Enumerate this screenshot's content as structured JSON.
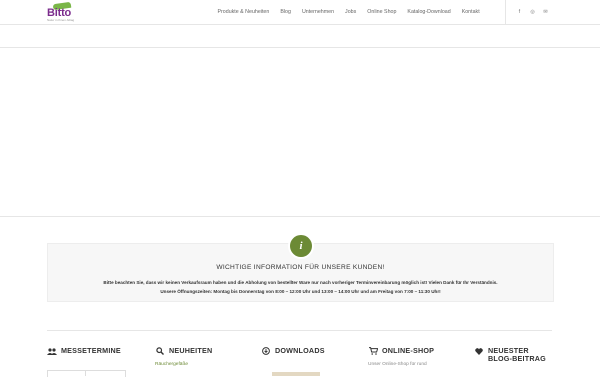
{
  "logo": {
    "brand": "Bitto",
    "tagline": "Natur in Ihrem Alltag"
  },
  "nav": {
    "items": [
      "Produkte & Neuheiten",
      "Blog",
      "Unternehmen",
      "Jobs",
      "Online Shop",
      "Katalog-Download",
      "Kontakt"
    ]
  },
  "social": [
    {
      "icon": "facebook-icon",
      "glyph": "f"
    },
    {
      "icon": "instagram-icon",
      "glyph": "◎"
    },
    {
      "icon": "mail-icon",
      "glyph": "✉"
    }
  ],
  "notice": {
    "icon": "info-icon",
    "glyph": "i",
    "title": "WICHTIGE INFORMATION FÜR UNSERE KUNDEN!",
    "line1": "Bitte beachten Sie, dass wir keinen Verkaufsraum haben und die Abholung von bestellter Ware nur nach vorheriger Terminvereinbarung möglich ist! Vielen Dank für Ihr Verständnis.",
    "line2": "Unsere Öffnungszeiten: Montag bis Donnerstag von 8:00 – 12:00 Uhr und 13:00 – 14:00 Uhr und am Freitag von 7:00 – 11:30 Uhr!"
  },
  "widgets": {
    "messetermine": {
      "title": "MESSETERMINE",
      "icon": "users-icon"
    },
    "neuheiten": {
      "title": "NEUHEITEN",
      "icon": "search-icon",
      "first_item": "Räuchergefäße"
    },
    "downloads": {
      "title": "DOWNLOADS",
      "icon": "download-icon"
    },
    "onlineshop": {
      "title": "ONLINE-SHOP",
      "icon": "cart-icon",
      "text": "Unser Online-Shop für rund"
    },
    "blog": {
      "title": "NEUESTER BLOG-BEITRAG",
      "icon": "heart-icon"
    }
  },
  "colors": {
    "brand_purple": "#7b2c8d",
    "brand_green": "#7ab648",
    "accent_green": "#6c8a35"
  }
}
